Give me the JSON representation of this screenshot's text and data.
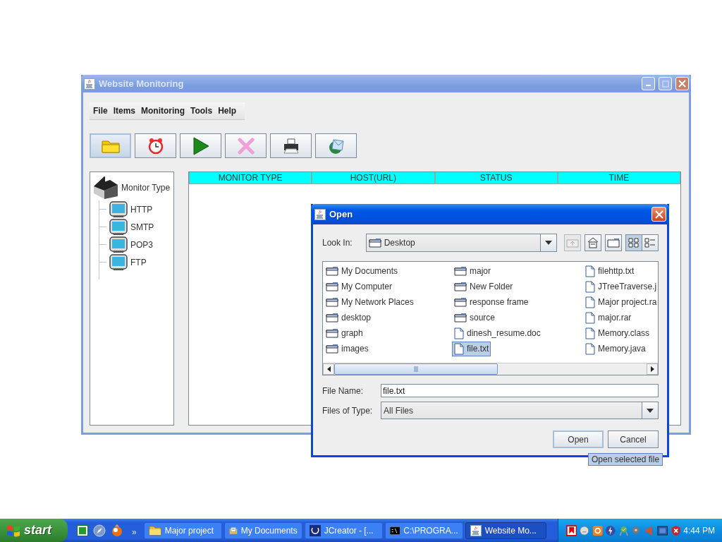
{
  "main_window": {
    "title": "Website Monitoring",
    "menu": [
      "File",
      "Items",
      "Monitoring",
      "Tools",
      "Help"
    ],
    "toolbar": [
      {
        "kind": "folder",
        "focused": true
      },
      {
        "kind": "alarm",
        "focused": false
      },
      {
        "kind": "play",
        "focused": false
      },
      {
        "kind": "delete",
        "focused": false
      },
      {
        "kind": "printer",
        "focused": false
      },
      {
        "kind": "mail",
        "focused": false
      }
    ],
    "tree": {
      "label": "Monitor Type",
      "children": [
        {
          "label": "HTTP"
        },
        {
          "label": "SMTP"
        },
        {
          "label": "POP3"
        },
        {
          "label": "FTP"
        }
      ]
    },
    "table": {
      "columns": [
        "MONITOR TYPE",
        "HOST(URL)",
        "STATUS",
        "TIME"
      ]
    }
  },
  "open_dialog": {
    "title": "Open",
    "look_in_label": "Look In:",
    "look_in": "Desktop",
    "files": [
      {
        "name": "My Documents",
        "kind": "folder",
        "selected": false
      },
      {
        "name": "My Computer",
        "kind": "folder",
        "selected": false
      },
      {
        "name": "My Network Places",
        "kind": "folder",
        "selected": false
      },
      {
        "name": "desktop",
        "kind": "folder",
        "selected": false
      },
      {
        "name": "graph",
        "kind": "folder",
        "selected": false
      },
      {
        "name": "images",
        "kind": "folder",
        "selected": false
      },
      {
        "name": "major",
        "kind": "folder",
        "selected": false
      },
      {
        "name": "New Folder",
        "kind": "folder",
        "selected": false
      },
      {
        "name": "response frame",
        "kind": "folder",
        "selected": false
      },
      {
        "name": "source",
        "kind": "folder",
        "selected": false
      },
      {
        "name": "dinesh_resume.doc",
        "kind": "file",
        "selected": false
      },
      {
        "name": "file.txt",
        "kind": "file",
        "selected": true
      },
      {
        "name": "filehttp.txt",
        "kind": "file",
        "selected": false
      },
      {
        "name": "JTreeTraverse.j",
        "kind": "file",
        "selected": false
      },
      {
        "name": "Major project.ra",
        "kind": "file",
        "selected": false
      },
      {
        "name": "major.rar",
        "kind": "file",
        "selected": false
      },
      {
        "name": "Memory.class",
        "kind": "file",
        "selected": false
      },
      {
        "name": "Memory.java",
        "kind": "file",
        "selected": false
      }
    ],
    "file_name_label": "File Name:",
    "file_name": "file.txt",
    "file_type_label": "Files of Type:",
    "file_type": "All Files",
    "buttons": [
      "Open",
      "Cancel"
    ],
    "tooltip": "Open selected file"
  },
  "taskbar": {
    "start": "start",
    "chevron": "»",
    "tasks": [
      {
        "label": "Major project",
        "kind": "folder",
        "selected": false
      },
      {
        "label": "My Documents",
        "kind": "documents",
        "selected": false
      },
      {
        "label": "JCreator - [...",
        "kind": "jcreator",
        "selected": false
      },
      {
        "label": "C:\\PROGRA...",
        "kind": "console",
        "selected": false
      },
      {
        "label": "Website Mo...",
        "kind": "java",
        "selected": true
      }
    ],
    "clock": "4:44 PM"
  }
}
